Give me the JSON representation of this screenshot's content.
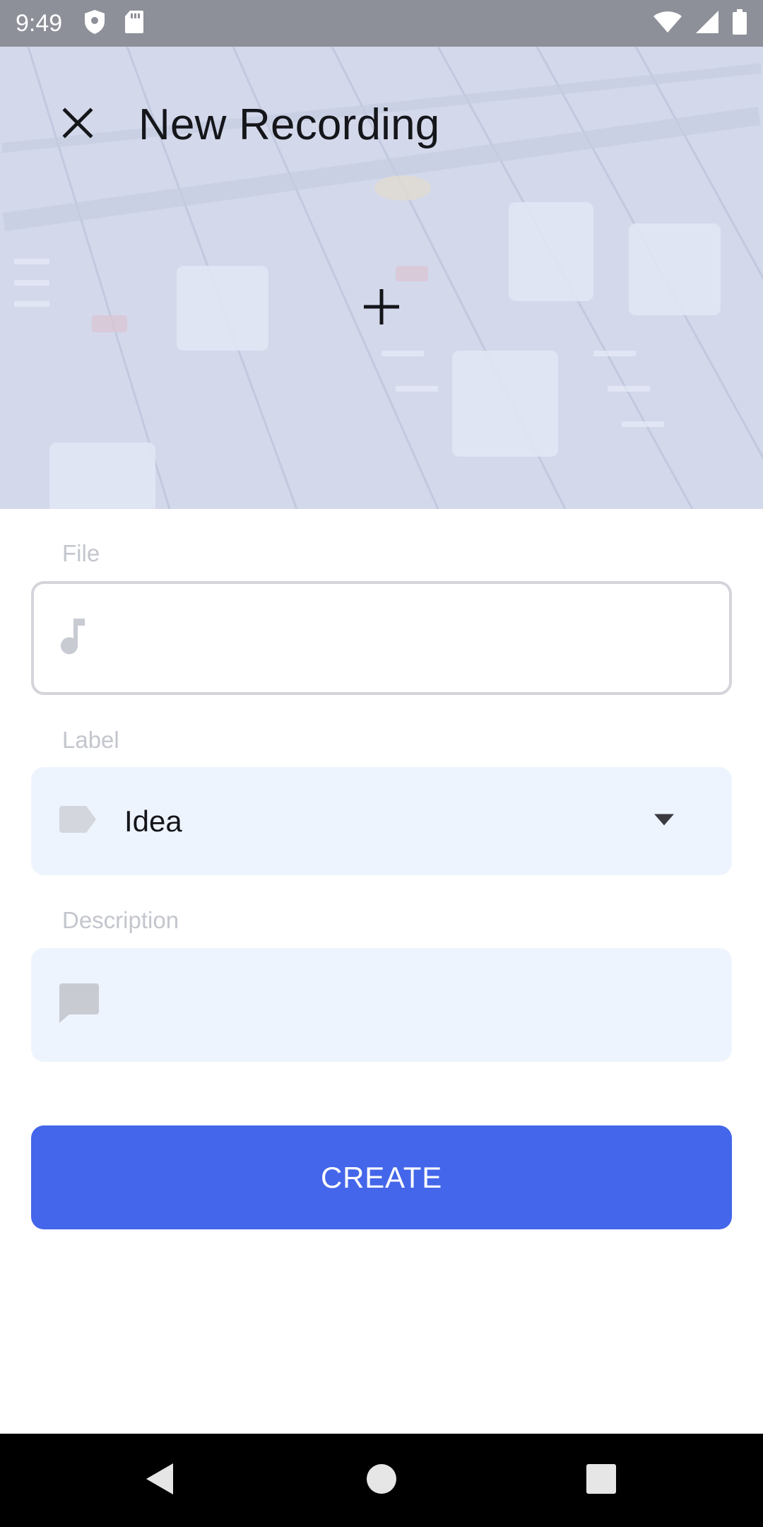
{
  "status_bar": {
    "time": "9:49",
    "icons": [
      "shield-icon",
      "sd-card-icon",
      "wifi-icon",
      "signal-icon",
      "battery-icon"
    ]
  },
  "header": {
    "title": "New Recording",
    "close_icon": "close-icon",
    "add_icon": "plus-icon"
  },
  "form": {
    "file": {
      "label": "File",
      "value": "",
      "icon": "music-note-icon"
    },
    "label": {
      "label": "Label",
      "value": "Idea",
      "icon": "label-tag-icon"
    },
    "description": {
      "label": "Description",
      "value": "",
      "icon": "comment-icon"
    }
  },
  "actions": {
    "create_label": "CREATE"
  },
  "nav_bar": {
    "icons": [
      "back-icon",
      "home-icon",
      "recents-icon"
    ]
  },
  "colors": {
    "accent": "#4466ea",
    "field_bg": "#eef4fe",
    "field_border": "#d4d5db",
    "label_text": "#c3c6cd",
    "icon_gray": "#c8cbd2"
  }
}
